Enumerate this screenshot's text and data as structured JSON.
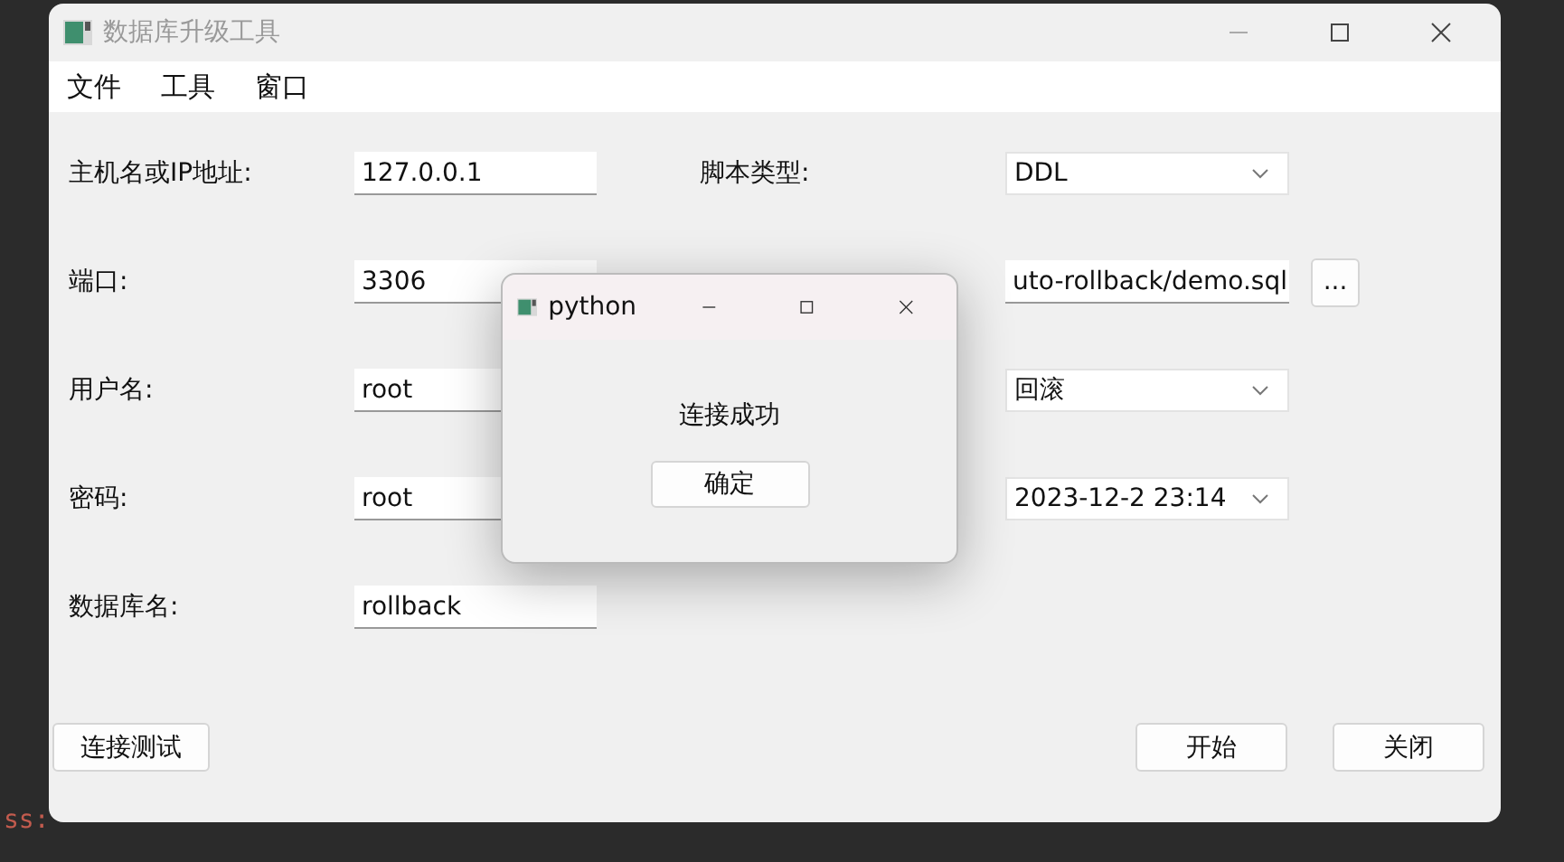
{
  "background": {
    "console_text": "ss:"
  },
  "window": {
    "title": "数据库升级工具",
    "menu": [
      "文件",
      "工具",
      "窗口"
    ]
  },
  "form": {
    "left": [
      {
        "label": "主机名或IP地址:",
        "value": "127.0.0.1"
      },
      {
        "label": "端口:",
        "value": "3306"
      },
      {
        "label": "用户名:",
        "value": "root"
      },
      {
        "label": "密码:",
        "value": "root"
      },
      {
        "label": "数据库名:",
        "value": "rollback"
      }
    ],
    "right": [
      {
        "label": "脚本类型:",
        "kind": "select",
        "value": "DDL"
      },
      {
        "kind": "file",
        "value": "uto-rollback/demo.sql",
        "button": "..."
      },
      {
        "kind": "select",
        "value": "回滚"
      },
      {
        "kind": "select",
        "value": "2023-12-2 23:14"
      }
    ]
  },
  "buttons": {
    "left": [
      "连接测试"
    ],
    "right": [
      "开始",
      "关闭"
    ]
  },
  "dialog": {
    "title": "python",
    "message": "连接成功",
    "button": "确定"
  }
}
